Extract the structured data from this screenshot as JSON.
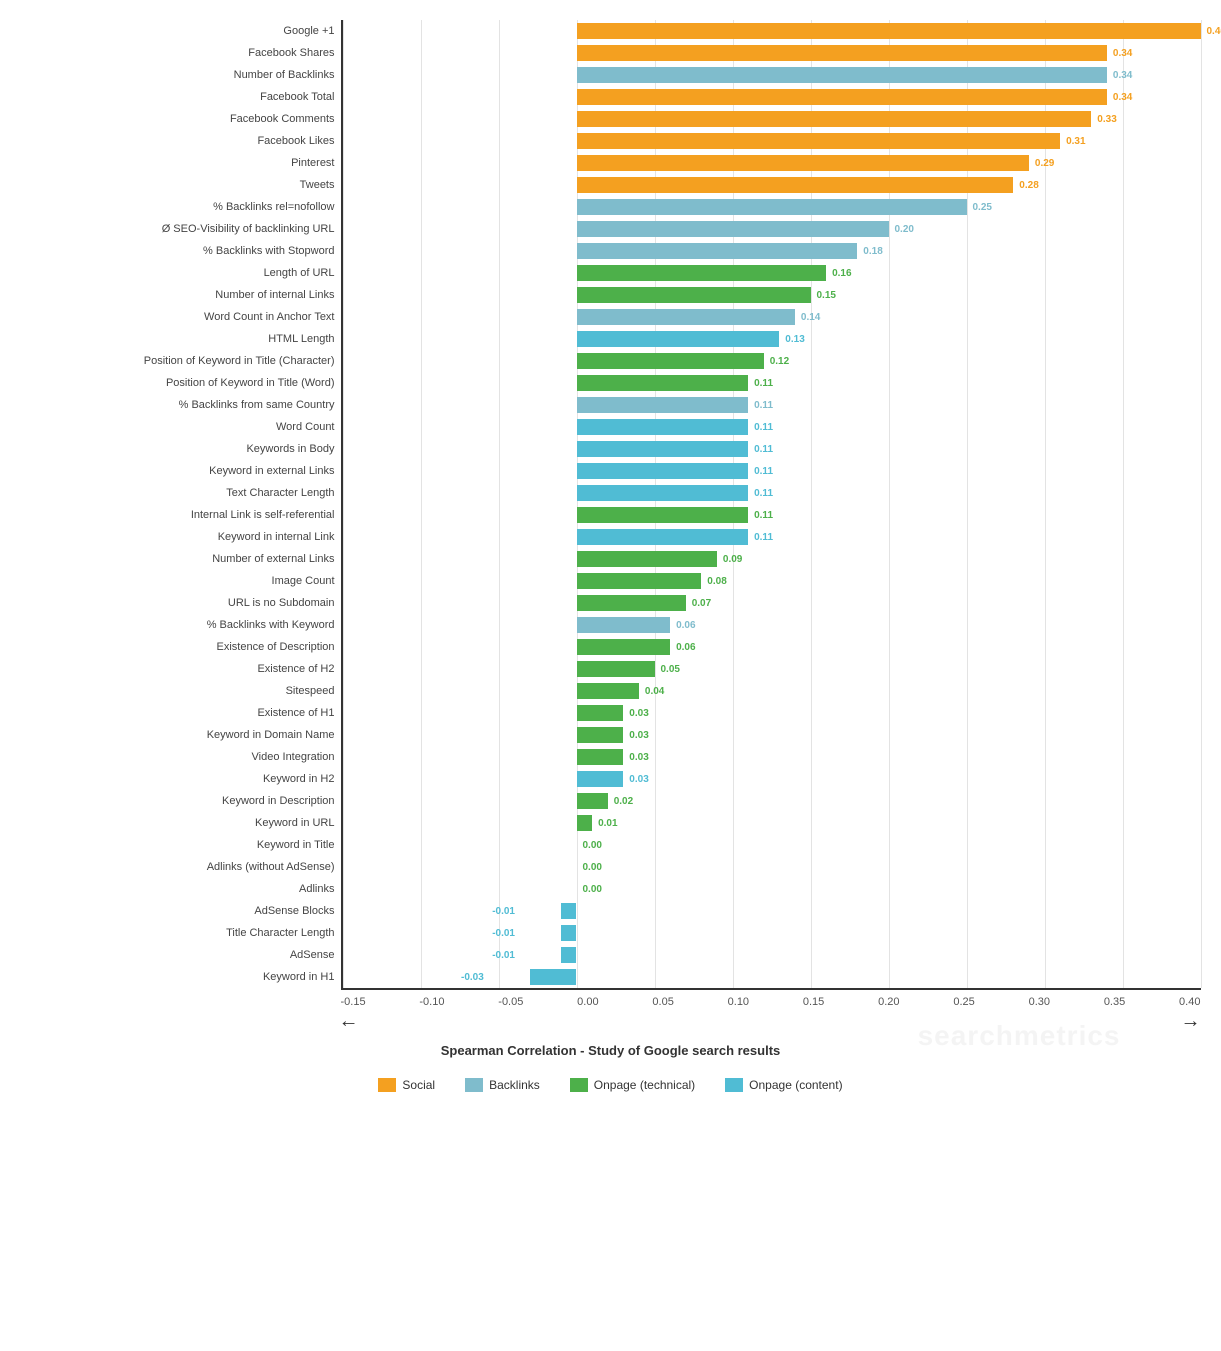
{
  "chart": {
    "subtitle": "Spearman Correlation - Study of Google search results",
    "zeroOffset": 0.15,
    "totalRange": 0.55,
    "bars": [
      {
        "label": "Google +1",
        "value": 0.4,
        "color": "#f4a020"
      },
      {
        "label": "Facebook Shares",
        "value": 0.34,
        "color": "#f4a020"
      },
      {
        "label": "Number of Backlinks",
        "value": 0.34,
        "color": "#7fbccc"
      },
      {
        "label": "Facebook Total",
        "value": 0.34,
        "color": "#f4a020"
      },
      {
        "label": "Facebook Comments",
        "value": 0.33,
        "color": "#f4a020"
      },
      {
        "label": "Facebook Likes",
        "value": 0.31,
        "color": "#f4a020"
      },
      {
        "label": "Pinterest",
        "value": 0.29,
        "color": "#f4a020"
      },
      {
        "label": "Tweets",
        "value": 0.28,
        "color": "#f4a020"
      },
      {
        "label": "% Backlinks rel=nofollow",
        "value": 0.25,
        "color": "#7fbccc"
      },
      {
        "label": "Ø SEO-Visibility of backlinking URL",
        "value": 0.2,
        "color": "#7fbccc"
      },
      {
        "label": "% Backlinks with Stopword",
        "value": 0.18,
        "color": "#7fbccc"
      },
      {
        "label": "Length of URL",
        "value": 0.16,
        "color": "#4db04a"
      },
      {
        "label": "Number of internal Links",
        "value": 0.15,
        "color": "#4db04a"
      },
      {
        "label": "Word Count in Anchor Text",
        "value": 0.14,
        "color": "#7fbccc"
      },
      {
        "label": "HTML Length",
        "value": 0.13,
        "color": "#50bcd4"
      },
      {
        "label": "Position of Keyword in Title (Character)",
        "value": 0.12,
        "color": "#4db04a"
      },
      {
        "label": "Position of Keyword in Title (Word)",
        "value": 0.11,
        "color": "#4db04a"
      },
      {
        "label": "% Backlinks from same Country",
        "value": 0.11,
        "color": "#7fbccc"
      },
      {
        "label": "Word Count",
        "value": 0.11,
        "color": "#50bcd4"
      },
      {
        "label": "Keywords in Body",
        "value": 0.11,
        "color": "#50bcd4"
      },
      {
        "label": "Keyword in external Links",
        "value": 0.11,
        "color": "#50bcd4"
      },
      {
        "label": "Text Character Length",
        "value": 0.11,
        "color": "#50bcd4"
      },
      {
        "label": "Internal Link is self-referential",
        "value": 0.11,
        "color": "#4db04a"
      },
      {
        "label": "Keyword in internal Link",
        "value": 0.11,
        "color": "#50bcd4"
      },
      {
        "label": "Number of external Links",
        "value": 0.09,
        "color": "#4db04a"
      },
      {
        "label": "Image Count",
        "value": 0.08,
        "color": "#4db04a"
      },
      {
        "label": "URL is no Subdomain",
        "value": 0.07,
        "color": "#4db04a"
      },
      {
        "label": "% Backlinks with Keyword",
        "value": 0.06,
        "color": "#7fbccc"
      },
      {
        "label": "Existence of Description",
        "value": 0.06,
        "color": "#4db04a"
      },
      {
        "label": "Existence of H2",
        "value": 0.05,
        "color": "#4db04a"
      },
      {
        "label": "Sitespeed",
        "value": 0.04,
        "color": "#4db04a"
      },
      {
        "label": "Existence of H1",
        "value": 0.03,
        "color": "#4db04a"
      },
      {
        "label": "Keyword in Domain Name",
        "value": 0.03,
        "color": "#4db04a"
      },
      {
        "label": "Video Integration",
        "value": 0.03,
        "color": "#4db04a"
      },
      {
        "label": "Keyword in H2",
        "value": 0.03,
        "color": "#50bcd4"
      },
      {
        "label": "Keyword in Description",
        "value": 0.02,
        "color": "#4db04a"
      },
      {
        "label": "Keyword in URL",
        "value": 0.01,
        "color": "#4db04a"
      },
      {
        "label": "Keyword in Title",
        "value": 0.0,
        "color": "#4db04a"
      },
      {
        "label": "Adlinks (without AdSense)",
        "value": 0.0,
        "color": "#4db04a"
      },
      {
        "label": "Adlinks",
        "value": 0.0,
        "color": "#4db04a"
      },
      {
        "label": "AdSense Blocks",
        "value": -0.01,
        "color": "#50bcd4"
      },
      {
        "label": "Title Character Length",
        "value": -0.01,
        "color": "#50bcd4"
      },
      {
        "label": "AdSense",
        "value": -0.01,
        "color": "#50bcd4"
      },
      {
        "label": "Keyword in H1",
        "value": -0.03,
        "color": "#50bcd4"
      }
    ],
    "legend": [
      {
        "label": "Social",
        "color": "#f4a020"
      },
      {
        "label": "Backlinks",
        "color": "#7fbccc"
      },
      {
        "label": "Onpage (technical)",
        "color": "#4db04a"
      },
      {
        "label": "Onpage (content)",
        "color": "#50bcd4"
      }
    ],
    "xAxis": {
      "ticks": [
        "-0.15",
        "-0.10",
        "-0.05",
        "0",
        "0.05",
        "0.10",
        "0.15",
        "0.20",
        "0.25",
        "0.30",
        "0.35",
        "0.40"
      ]
    }
  }
}
